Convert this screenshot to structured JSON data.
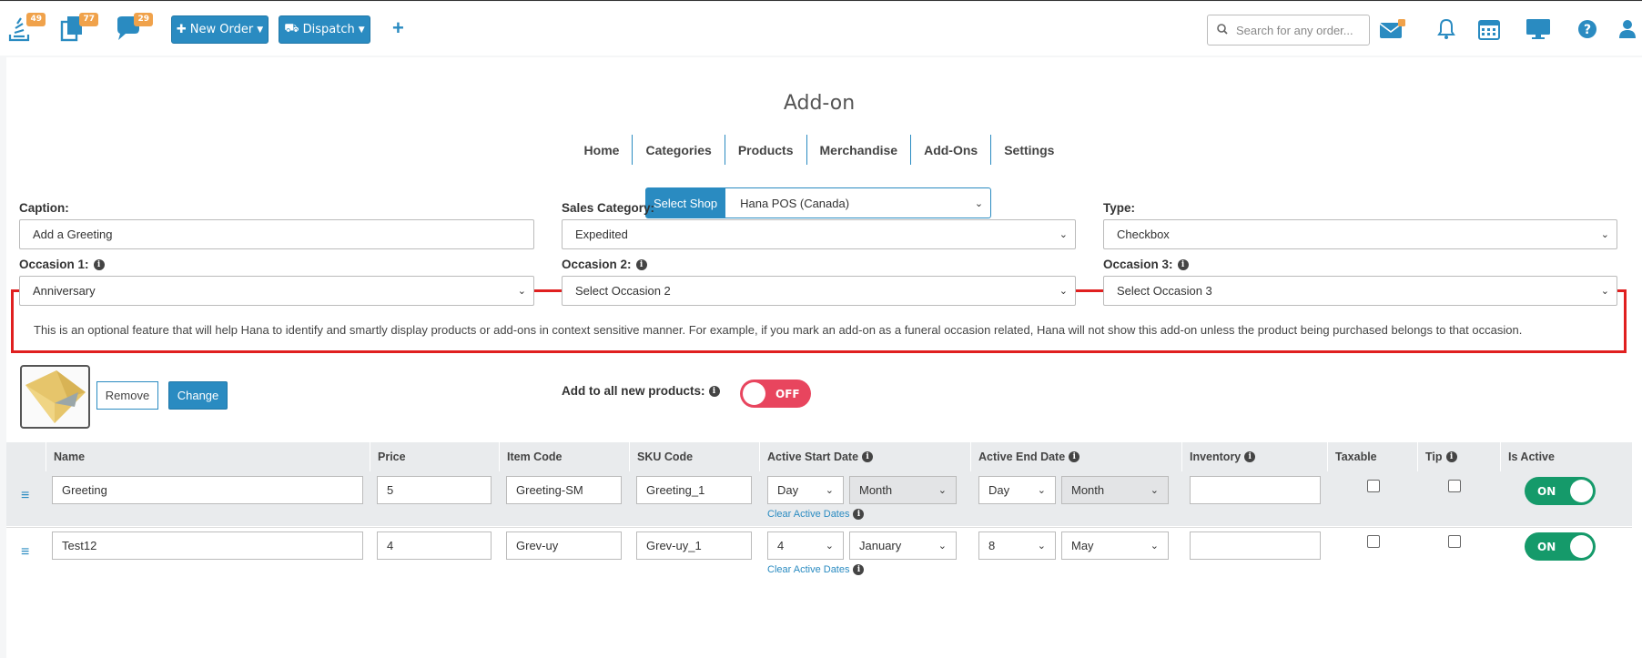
{
  "topbar": {
    "badges": {
      "orders": "49",
      "copies": "77",
      "messages": "29"
    },
    "new_order": "New Order",
    "dispatch": "Dispatch",
    "plus": "+",
    "search_placeholder": "Search for any order..."
  },
  "page": {
    "title": "Add-on",
    "tabs": [
      "Home",
      "Categories",
      "Products",
      "Merchandise",
      "Add-Ons",
      "Settings"
    ]
  },
  "shop": {
    "label": "Select Shop",
    "value": "Hana POS (Canada)"
  },
  "form": {
    "caption_label": "Caption:",
    "caption_value": "Add a Greeting",
    "sales_category_label": "Sales Category:",
    "sales_category_value": "Expedited",
    "type_label": "Type:",
    "type_value": "Checkbox",
    "occasion1_label": "Occasion 1:",
    "occasion1_value": "Anniversary",
    "occasion2_label": "Occasion 2:",
    "occasion2_value": "Select Occasion 2",
    "occasion3_label": "Occasion 3:",
    "occasion3_value": "Select Occasion 3",
    "note": "This is an optional feature that will help Hana to identify and smartly display products or add-ons in context sensitive manner. For example, if you mark an add-on as a funeral occasion related, Hana will not show this add-on unless the product being purchased belongs to that occasion.",
    "remove_label": "Remove",
    "change_label": "Change",
    "add_all_label": "Add to all new products:",
    "add_all_toggle": "OFF"
  },
  "table": {
    "headers": [
      "Name",
      "Price",
      "Item Code",
      "SKU Code",
      "Active Start Date",
      "Active End Date",
      "Inventory",
      "Taxable",
      "Tip",
      "Is Active"
    ],
    "clear_label": "Clear Active Dates",
    "rows": [
      {
        "name": "Greeting",
        "price": "5",
        "item_code": "Greeting-SM",
        "sku": "Greeting_1",
        "start_day": "Day",
        "start_month": "Month",
        "end_day": "Day",
        "end_month": "Month",
        "inventory": "",
        "active": "ON"
      },
      {
        "name": "Test12",
        "price": "4",
        "item_code": "Grev-uy",
        "sku": "Grev-uy_1",
        "start_day": "4",
        "start_month": "January",
        "end_day": "8",
        "end_month": "May",
        "inventory": "",
        "active": "ON"
      }
    ]
  },
  "colors": {
    "accent": "#2a8bc1",
    "badge": "#f0a24b",
    "off": "#e8455e",
    "on": "#159a6a",
    "highlight": "#e02020"
  }
}
